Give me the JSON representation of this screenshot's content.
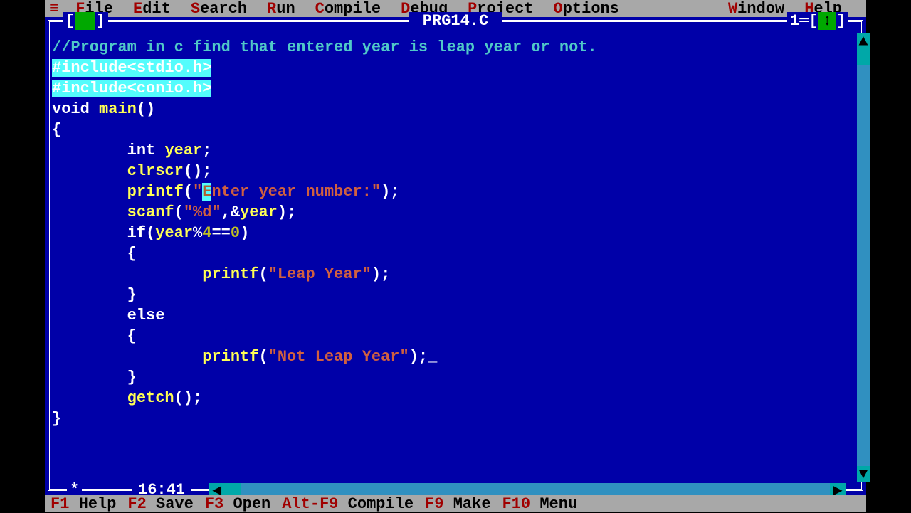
{
  "menubar": {
    "ctrl": "≡",
    "items": [
      {
        "hot": "F",
        "rest": "ile"
      },
      {
        "hot": "E",
        "rest": "dit"
      },
      {
        "hot": "S",
        "rest": "earch"
      },
      {
        "hot": "R",
        "rest": "un"
      },
      {
        "hot": "C",
        "rest": "ompile"
      },
      {
        "hot": "D",
        "rest": "ebug"
      },
      {
        "hot": "P",
        "rest": "roject"
      },
      {
        "hot": "O",
        "rest": "ptions"
      }
    ],
    "right_items": [
      {
        "hot": "W",
        "rest": "indow"
      },
      {
        "hot": "H",
        "rest": "elp"
      }
    ]
  },
  "window": {
    "title": "PRG14.C",
    "left_bracket": "[",
    "right_bracket": "]",
    "window_number": "1",
    "arrow": "↕",
    "modified": "*",
    "cursor_pos": "16:41"
  },
  "code": {
    "lines": [
      {
        "type": "comment",
        "text": "//Program in c find that entered year is leap year or not."
      },
      {
        "type": "pphl",
        "text": "#include<stdio.h>"
      },
      {
        "type": "pphl",
        "text": "#include<conio.h>"
      },
      {
        "type": "plain",
        "segs": [
          {
            "c": "kw",
            "t": "void "
          },
          {
            "c": "id",
            "t": "main"
          },
          {
            "c": "kw",
            "t": "()"
          }
        ]
      },
      {
        "type": "plain",
        "segs": [
          {
            "c": "kw",
            "t": "{"
          }
        ]
      },
      {
        "type": "plain",
        "indent": 8,
        "segs": [
          {
            "c": "kw",
            "t": "int "
          },
          {
            "c": "id",
            "t": "year"
          },
          {
            "c": "kw",
            "t": ";"
          }
        ]
      },
      {
        "type": "plain",
        "indent": 8,
        "segs": [
          {
            "c": "id",
            "t": "clrscr"
          },
          {
            "c": "kw",
            "t": "();"
          }
        ]
      },
      {
        "type": "plain",
        "indent": 8,
        "segs": [
          {
            "c": "id",
            "t": "printf"
          },
          {
            "c": "kw",
            "t": "("
          },
          {
            "c": "str",
            "t": "\""
          },
          {
            "c": "cur",
            "t": "E"
          },
          {
            "c": "str",
            "t": "nter year number:\""
          },
          {
            "c": "kw",
            "t": ");"
          }
        ]
      },
      {
        "type": "plain",
        "indent": 8,
        "segs": [
          {
            "c": "id",
            "t": "scanf"
          },
          {
            "c": "kw",
            "t": "("
          },
          {
            "c": "str",
            "t": "\"%d\""
          },
          {
            "c": "kw",
            "t": ",&"
          },
          {
            "c": "id",
            "t": "year"
          },
          {
            "c": "kw",
            "t": ");"
          }
        ]
      },
      {
        "type": "plain",
        "indent": 8,
        "segs": [
          {
            "c": "kw",
            "t": "if("
          },
          {
            "c": "id",
            "t": "year"
          },
          {
            "c": "kw",
            "t": "%"
          },
          {
            "c": "num",
            "t": "4"
          },
          {
            "c": "kw",
            "t": "=="
          },
          {
            "c": "num",
            "t": "0"
          },
          {
            "c": "kw",
            "t": ")"
          }
        ]
      },
      {
        "type": "plain",
        "indent": 8,
        "segs": [
          {
            "c": "kw",
            "t": "{"
          }
        ]
      },
      {
        "type": "plain",
        "indent": 16,
        "segs": [
          {
            "c": "id",
            "t": "printf"
          },
          {
            "c": "kw",
            "t": "("
          },
          {
            "c": "str",
            "t": "\"Leap Year\""
          },
          {
            "c": "kw",
            "t": ");"
          }
        ]
      },
      {
        "type": "plain",
        "indent": 8,
        "segs": [
          {
            "c": "kw",
            "t": "}"
          }
        ]
      },
      {
        "type": "plain",
        "indent": 8,
        "segs": [
          {
            "c": "kw",
            "t": "else"
          }
        ]
      },
      {
        "type": "plain",
        "indent": 8,
        "segs": [
          {
            "c": "kw",
            "t": "{"
          }
        ]
      },
      {
        "type": "plain",
        "indent": 16,
        "segs": [
          {
            "c": "id",
            "t": "printf"
          },
          {
            "c": "kw",
            "t": "("
          },
          {
            "c": "str",
            "t": "\"Not Leap Year\""
          },
          {
            "c": "kw",
            "t": ");_"
          }
        ]
      },
      {
        "type": "plain",
        "indent": 8,
        "segs": [
          {
            "c": "kw",
            "t": "}"
          }
        ]
      },
      {
        "type": "plain",
        "indent": 8,
        "segs": [
          {
            "c": "id",
            "t": "getch"
          },
          {
            "c": "kw",
            "t": "();"
          }
        ]
      },
      {
        "type": "plain",
        "segs": [
          {
            "c": "kw",
            "t": "}"
          }
        ]
      }
    ]
  },
  "status": {
    "items": [
      {
        "key": "F1",
        "label": " Help"
      },
      {
        "key": "F2",
        "label": " Save"
      },
      {
        "key": "F3",
        "label": " Open"
      },
      {
        "key": "Alt-F9",
        "label": " Compile"
      },
      {
        "key": "F9",
        "label": " Make"
      },
      {
        "key": "F10",
        "label": " Menu"
      }
    ]
  },
  "scroll": {
    "arrL": "◄",
    "arrR": "►",
    "arrU": "▲",
    "arrD": "▼"
  }
}
